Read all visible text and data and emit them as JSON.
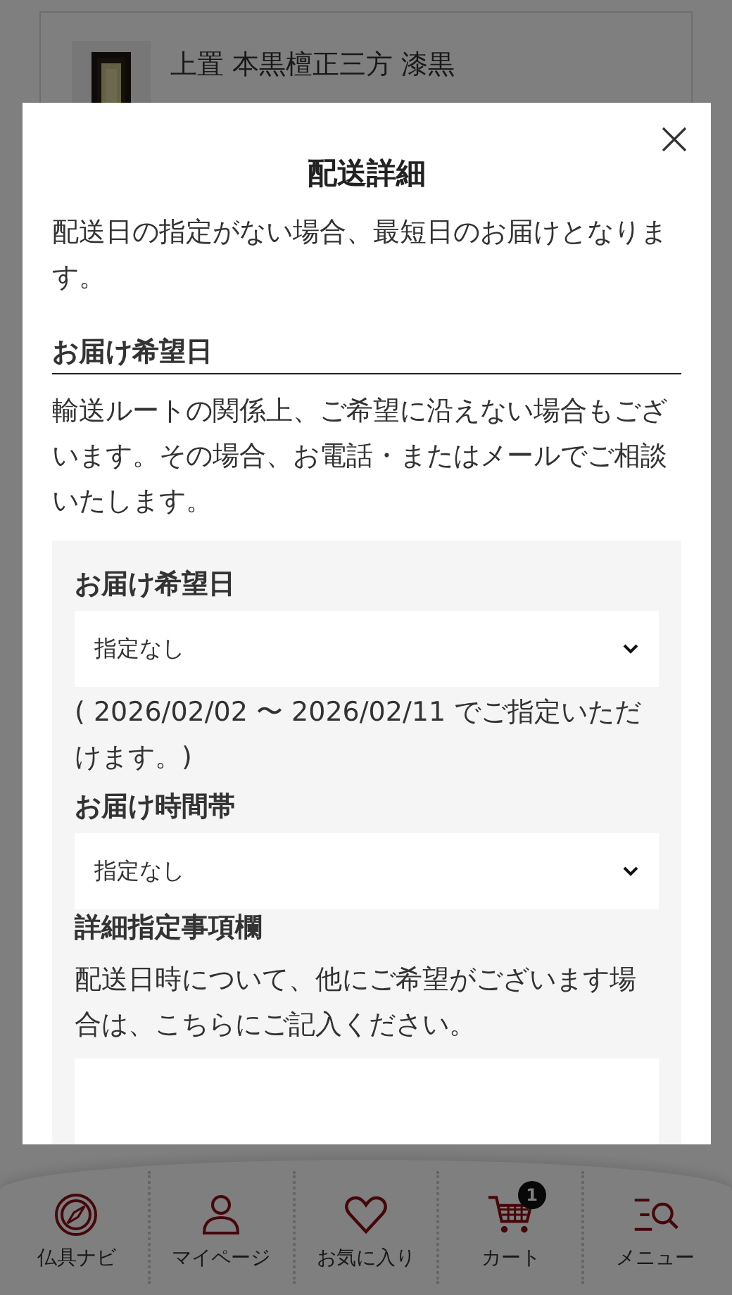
{
  "background_page": {
    "product": {
      "name": "上置 本黒檀正三方 漆黒"
    }
  },
  "modal": {
    "title": "配送詳細",
    "intro": "配送日の指定がない場合、最短日のお届けとなります。",
    "section": {
      "heading": "お届け希望日",
      "note": "輸送ルートの関係上、ご希望に沿えない場合もございます。その場合、お電話・またはメールでご相談いたします。"
    },
    "fields": [
      {
        "kind": "select",
        "label": "お届け希望日",
        "value": "指定なし",
        "help": "( 2026/02/02 〜 2026/02/11 でご指定いただけます。)"
      },
      {
        "kind": "select",
        "label": "お届け時間帯",
        "value": "指定なし"
      },
      {
        "kind": "textarea",
        "label": "詳細指定事項欄",
        "description": "配送日時について、他にご希望がございます場合は、こちらにご記入ください。"
      }
    ]
  },
  "bottom_nav": [
    {
      "kind": "compass",
      "label": "仏具ナビ"
    },
    {
      "kind": "person",
      "label": "マイページ"
    },
    {
      "kind": "heart",
      "label": "お気に入り"
    },
    {
      "kind": "cart",
      "label": "カート",
      "badge": "1"
    },
    {
      "kind": "menu",
      "label": "メニュー"
    }
  ]
}
